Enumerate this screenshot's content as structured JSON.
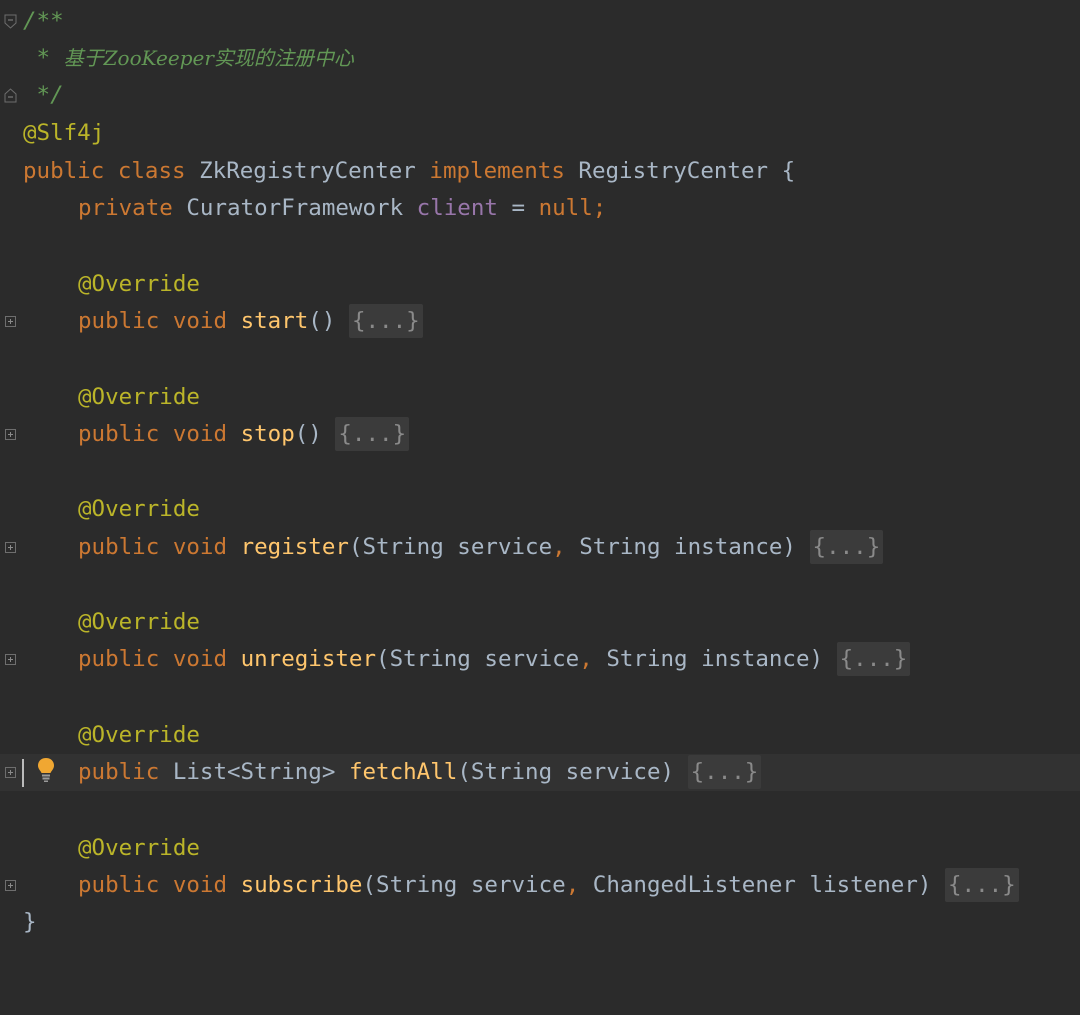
{
  "editor": {
    "doc_comment": {
      "open": "/**",
      "star": "* ",
      "text": "基于ZooKeeper实现的注册中心",
      "close": "*/"
    },
    "annotation_slf4j": "@Slf4j",
    "class_decl": {
      "public": "public",
      "class": "class",
      "name": "ZkRegistryCenter",
      "implements": "implements",
      "iface": "RegistryCenter",
      "brace": "{"
    },
    "field_decl": {
      "private": "private",
      "type": "CuratorFramework",
      "name": "client",
      "eq": " = ",
      "value": "null",
      "semi": ";"
    },
    "override": "@Override",
    "methods": [
      {
        "public": "public",
        "ret": "void",
        "name": "start",
        "params_text": "()",
        "fold": "{...}"
      },
      {
        "public": "public",
        "ret": "void",
        "name": "stop",
        "params_text": "()",
        "fold": "{...}"
      },
      {
        "public": "public",
        "ret": "void",
        "name": "register",
        "p1": "(String service",
        "comma": ",",
        "p2": " String instance)",
        "fold": "{...}"
      },
      {
        "public": "public",
        "ret": "void",
        "name": "unregister",
        "p1": "(String service",
        "comma": ",",
        "p2": " String instance)",
        "fold": "{...}"
      },
      {
        "public": "public",
        "ret": "List<String>",
        "name": "fetchAll",
        "params_text": "(String service)",
        "fold": "{...}"
      },
      {
        "public": "public",
        "ret": "void",
        "name": "subscribe",
        "p1": "(String service",
        "comma": ",",
        "p2": " ChangedListener listener)",
        "fold": "{...}"
      }
    ],
    "class_close": "}",
    "icons": {
      "fold_marker": "fold-marker-icon",
      "intention_bulb": "lightbulb-icon"
    },
    "colors": {
      "background": "#2b2b2b",
      "keyword": "#cc7832",
      "annotation": "#bbb529",
      "method": "#ffc66d",
      "field": "#9876aa",
      "comment": "#629755",
      "text": "#a9b7c6"
    }
  }
}
